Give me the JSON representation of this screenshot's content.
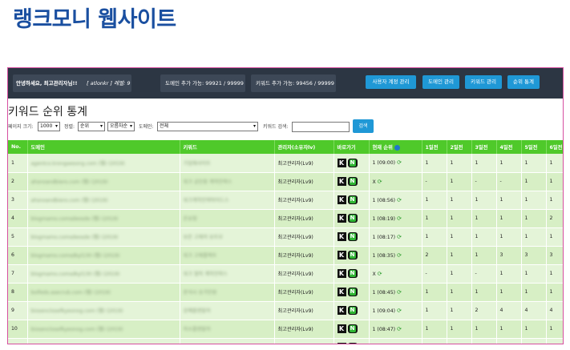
{
  "page_title": "랭크모니 웹사이트",
  "topbar": {
    "greeting": "안녕하세요, 최고관리자님!!",
    "user_meta": "[ atlonkr ] 레벨: 9",
    "domain_quota": "도메인 추가 가능: 99921 / 99999",
    "keyword_quota": "키워드 추가 가능: 99456 / 99999",
    "buttons": [
      "사용자 계정 관리",
      "도메인 관리",
      "키워드 관리",
      "순위 통계"
    ]
  },
  "heading": "키워드 순위 통계",
  "filters": {
    "page_size_label": "페이지 크기:",
    "page_size_value": "1000",
    "sort_label": "정렬:",
    "sort_value": "순위",
    "order_value": "오름차순",
    "domain_label": "도메인:",
    "domain_value": "전체",
    "keyword_label": "키워드 검색:",
    "keyword_placeholder": "",
    "search_button": "검색"
  },
  "table": {
    "columns": [
      "No.",
      "도메인",
      "키워드",
      "관리자(소유자lv)",
      "바로가기",
      "현재 순위",
      "1일전",
      "2일전",
      "3일전",
      "4일전",
      "5일전",
      "6일전"
    ],
    "rows": [
      {
        "no": "1",
        "domain": "agentco.krongaesong.com (웹) (2019)",
        "keyword": "기업체사이트",
        "owner": "최고관리자(Lv9)",
        "rank": "1 (09:00)",
        "d": [
          "1",
          "1",
          "1",
          "1",
          "1",
          "1"
        ]
      },
      {
        "no": "2",
        "domain": "ahsnoandbiero.com (웹) (2019)",
        "keyword": "워크 공인중 계약전략스",
        "owner": "최고관리자(Lv9)",
        "rank": "X",
        "d": [
          "-",
          "1",
          "-",
          "-",
          "1",
          "1"
        ]
      },
      {
        "no": "3",
        "domain": "ahsnoandbiero.com (웹) (2019)",
        "keyword": "워크계약전략마이드스",
        "owner": "최고관리자(Lv9)",
        "rank": "1 (08:56)",
        "d": [
          "1",
          "1",
          "1",
          "1",
          "1",
          "1"
        ]
      },
      {
        "no": "4",
        "domain": "blogmamo.comsdeosde (웹) (2019)",
        "keyword": "온유형",
        "owner": "최고관리자(Lv9)",
        "rank": "1 (08:19)",
        "d": [
          "1",
          "1",
          "1",
          "1",
          "1",
          "2"
        ]
      },
      {
        "no": "5",
        "domain": "blogmamo.comsdeosde (웹) (2019)",
        "keyword": "보온 고체의 유트모",
        "owner": "최고관리자(Lv9)",
        "rank": "1 (08:17)",
        "d": [
          "1",
          "1",
          "1",
          "1",
          "1",
          "1"
        ]
      },
      {
        "no": "6",
        "domain": "blogmamo.comsdkyl130 (웹) (2019)",
        "keyword": "워크 고체플렉트",
        "owner": "최고관리자(Lv9)",
        "rank": "1 (08:35)",
        "d": [
          "2",
          "1",
          "1",
          "3",
          "3",
          "3"
        ]
      },
      {
        "no": "7",
        "domain": "blogmamo.comsdkyl130 (웹) (2019)",
        "keyword": "워크 열적 계약전략스",
        "owner": "최고관리자(Lv9)",
        "rank": "X",
        "d": [
          "-",
          "1",
          "-",
          "1",
          "1",
          "1"
        ]
      },
      {
        "no": "8",
        "domain": "bolfeds.asecrub.com (웹) (2019)",
        "keyword": "분석시 승가안원",
        "owner": "최고관리자(Lv9)",
        "rank": "1 (08:45)",
        "d": [
          "1",
          "1",
          "1",
          "1",
          "1",
          "1"
        ]
      },
      {
        "no": "9",
        "domain": "biosenclosefkyeonog.com (웹) (2019)",
        "keyword": "강예블렌말하",
        "owner": "최고관리자(Lv9)",
        "rank": "1 (09:04)",
        "d": [
          "1",
          "1",
          "2",
          "4",
          "4",
          "4"
        ]
      },
      {
        "no": "10",
        "domain": "biosenclosefkyeonog.com (웹) (2019)",
        "keyword": "하소플렌말하",
        "owner": "최고관리자(Lv9)",
        "rank": "1 (08:47)",
        "d": [
          "1",
          "1",
          "1",
          "1",
          "1",
          "1"
        ]
      }
    ]
  },
  "icons": {
    "k": "K",
    "n": "N"
  }
}
